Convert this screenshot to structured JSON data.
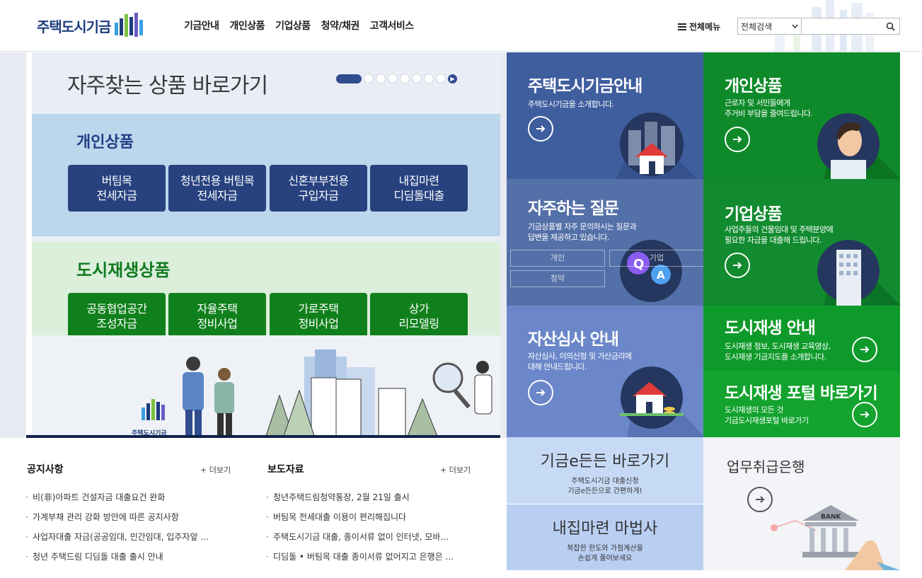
{
  "header": {
    "logo_text": "주택도시기금",
    "nav": [
      "기금안내",
      "개인상품",
      "기업상품",
      "청약/채권",
      "고객서비스"
    ],
    "all_menu_label": "전체메뉴",
    "search": {
      "scope_selected": "전체검색",
      "placeholder": ""
    }
  },
  "banner": {
    "title": "자주찾는 상품 바로가기",
    "pager": {
      "total": 8,
      "active": 1
    },
    "personal": {
      "heading": "개인상품",
      "buttons": [
        "버팀목\n전세자금",
        "청년전용 버팀목\n전세자금",
        "신혼부부전용\n구입자금",
        "내집마련\n디딤돌대출"
      ]
    },
    "urban": {
      "heading": "도시재생상품",
      "buttons": [
        "공동협업공간\n조성자금",
        "자율주택\n정비사업",
        "가로주택\n정비사업",
        "상가\n리모델링"
      ]
    },
    "illus_logo_text": "주택도시기금"
  },
  "tiles": {
    "fund": {
      "title": "주택도시기금안내",
      "desc": "주택도시기금을 소개합니다.",
      "color": "#3f5e9e"
    },
    "personal": {
      "title": "개인상품",
      "desc": "근로자 및 서민들에게\n주거비 부담을 줄여드립니다.",
      "color": "#0f8a2a"
    },
    "faq": {
      "title": "자주하는 질문",
      "desc": "기금상품별 자주 문의하시는 질문과\n답변을 제공하고 있습니다.",
      "buttons": [
        "개인",
        "기업",
        "청약"
      ],
      "color": "#5470a8"
    },
    "corporate": {
      "title": "기업상품",
      "desc": "사업주들의 건물임대 및 주택분양에\n필요한 자금을 대출해 드립니다.",
      "color": "#128b30"
    },
    "asset": {
      "title": "자산심사 안내",
      "desc": "자산심사, 이의신청 및 가산금리에\n대해 안내드립니다.",
      "color": "#6b87c9"
    },
    "urban_guide": {
      "title": "도시재생 안내",
      "desc": "도시재생 정보, 도시재생 교육영상,\n도시재생 기금지도를 소개합니다.",
      "color": "#0e9a2a"
    },
    "urban_portal": {
      "title": "도시재생 포털 바로가기",
      "desc": "도시재생의 모든 것\n기금도시재생포털 바로가기",
      "color": "#13a32e"
    }
  },
  "notices": {
    "title": "공지사항",
    "more": "+ 더보기",
    "items": [
      "비(非)아파트 건설자금 대출요건 완화",
      "가계부채 관리 강화 방안에 따른 공지사항",
      "사업자대출 자금(공공임대, 민간임대, 입주자앞 ...",
      "청년 주택드림 디딤돌 대출 출시 안내"
    ]
  },
  "press": {
    "title": "보도자료",
    "more": "+ 더보기",
    "items": [
      "청년주택드림청약통장, 2월 21일 출시",
      "버팀목 전세대출 이용이 편리해집니다",
      "주택도시기금 대출, 종이서류 없이 인터넷, 모바...",
      "디딤돌 • 버팀목 대출 종이서류 없어지고 은행은 ..."
    ]
  },
  "quick": {
    "edeundeun": {
      "title": "기금e든든 바로가기",
      "desc": "주택도시기금 대출신청\n기금e든든으로 간편하게!"
    },
    "magic": {
      "title": "내집마련 마법사",
      "desc": "복잡한 한도와 가점계산을\n손쉽게 풀어보세요"
    },
    "bank": {
      "title": "업무취급은행",
      "sign": "BANK"
    }
  }
}
